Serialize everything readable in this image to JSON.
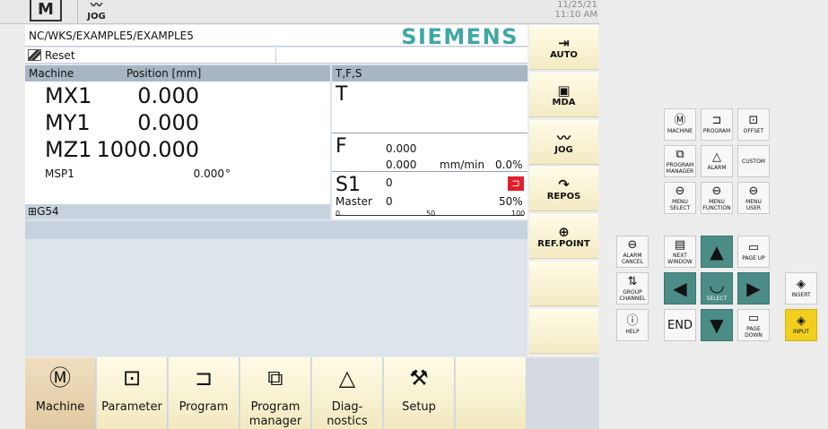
{
  "header": {
    "mode_machine": "M",
    "mode_jog": "JOG",
    "date": "11/25/21",
    "time": "11:10 AM"
  },
  "main": {
    "path": "NC/WKS/EXAMPLE5/EXAMPLE5",
    "brand": "SIEMENS",
    "status": "Reset",
    "machine_header": "Machine",
    "position_header": "Position [mm]",
    "tfs_header": "T,F,S",
    "axes": [
      {
        "name": "MX1",
        "value": "0.000"
      },
      {
        "name": "MY1",
        "value": "0.000"
      },
      {
        "name": "MZ1",
        "value": "1000.000"
      }
    ],
    "spindle_axis": {
      "name": "MSP1",
      "value": "0.000",
      "unit": "°"
    },
    "work_offset": "G54",
    "tfs": {
      "t_label": "T",
      "f_label": "F",
      "f_value": "0.000",
      "f_actual": "0.000",
      "f_unit": "mm/min",
      "f_override": "0.0%",
      "s_label": "S1",
      "s_value": "0",
      "master_label": "Master",
      "master_value": "0",
      "s_override": "50%",
      "ticks": [
        "0",
        "50",
        "100"
      ]
    }
  },
  "vertical_softkeys": [
    {
      "label": "AUTO",
      "icon": "arrow-right-bar-icon"
    },
    {
      "label": "MDA",
      "icon": "mda-icon"
    },
    {
      "label": "JOG",
      "icon": "jog-wave-icon"
    },
    {
      "label": "REPOS",
      "icon": "repos-arrow-icon"
    },
    {
      "label": "REF.POINT",
      "icon": "ref-point-icon"
    },
    {
      "label": ""
    },
    {
      "label": ""
    },
    {
      "label": ""
    }
  ],
  "horizontal_softkeys": [
    {
      "label": "Machine",
      "active": true
    },
    {
      "label": "Parameter"
    },
    {
      "label": "Program"
    },
    {
      "label": "Program manager"
    },
    {
      "label": "Diag-nostics"
    },
    {
      "label": "Setup"
    },
    {
      "label": ""
    },
    {
      "label": ""
    }
  ],
  "keypad": {
    "machine": "MACHINE",
    "program": "PROGRAM",
    "offset": "OFFSET",
    "program_manager": "PROGRAM MANAGER",
    "alarm": "ALARM",
    "custom": "CUSTOM",
    "menu_select": "MENU SELECT",
    "menu_function": "MENU FUNCTION",
    "menu_user": "MENU USER",
    "alarm_cancel": "ALARM CANCEL",
    "next_window": "NEXT WINDOW",
    "page_up": "PAGE UP",
    "group_channel": "GROUP CHANNEL",
    "select": "SELECT",
    "insert": "INSERT",
    "help": "HELP",
    "end": "END",
    "page_down": "PAGE DOWN",
    "input": "INPUT"
  }
}
